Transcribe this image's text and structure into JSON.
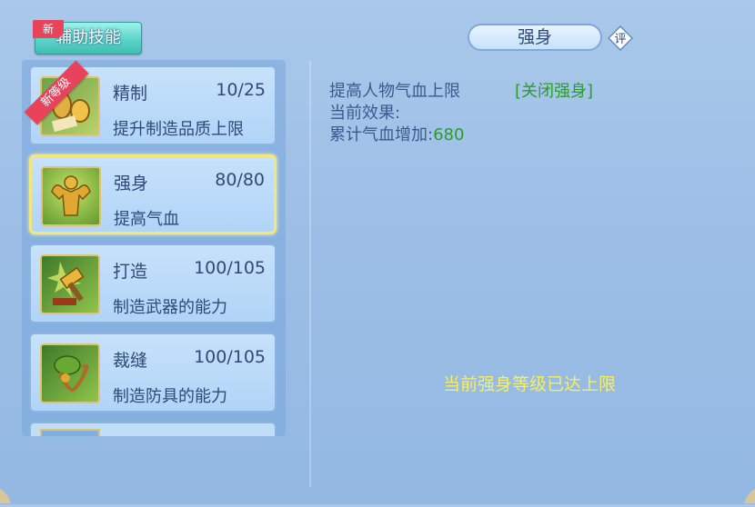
{
  "tab": {
    "label": "辅助技能",
    "badge": "新"
  },
  "skills": [
    {
      "name": "精制",
      "level": "10/25",
      "desc": "提升制造品质上限",
      "ribbon": "新等级",
      "selected": false
    },
    {
      "name": "强身",
      "level": "80/80",
      "desc": "提高气血",
      "ribbon": "",
      "selected": true
    },
    {
      "name": "打造",
      "level": "100/105",
      "desc": "制造武器的能力",
      "ribbon": "",
      "selected": false
    },
    {
      "name": "裁缝",
      "level": "100/105",
      "desc": "制造防具的能力",
      "ribbon": "",
      "selected": false
    }
  ],
  "detail": {
    "title": "强身",
    "rate_label": "评",
    "line1": "提高人物气血上限",
    "toggle": "[关闭强身]",
    "line2": "当前效果:",
    "line3_label": "累计气血增加:",
    "line3_value": "680",
    "notice": "当前强身等级已达上限"
  },
  "icons": [
    "refine-icon",
    "strength-icon",
    "forge-icon",
    "tailor-icon"
  ],
  "colors": {
    "accent_green": "#2a9c2a",
    "notice_yellow": "#f6ef62",
    "badge_red": "#e8435a"
  }
}
